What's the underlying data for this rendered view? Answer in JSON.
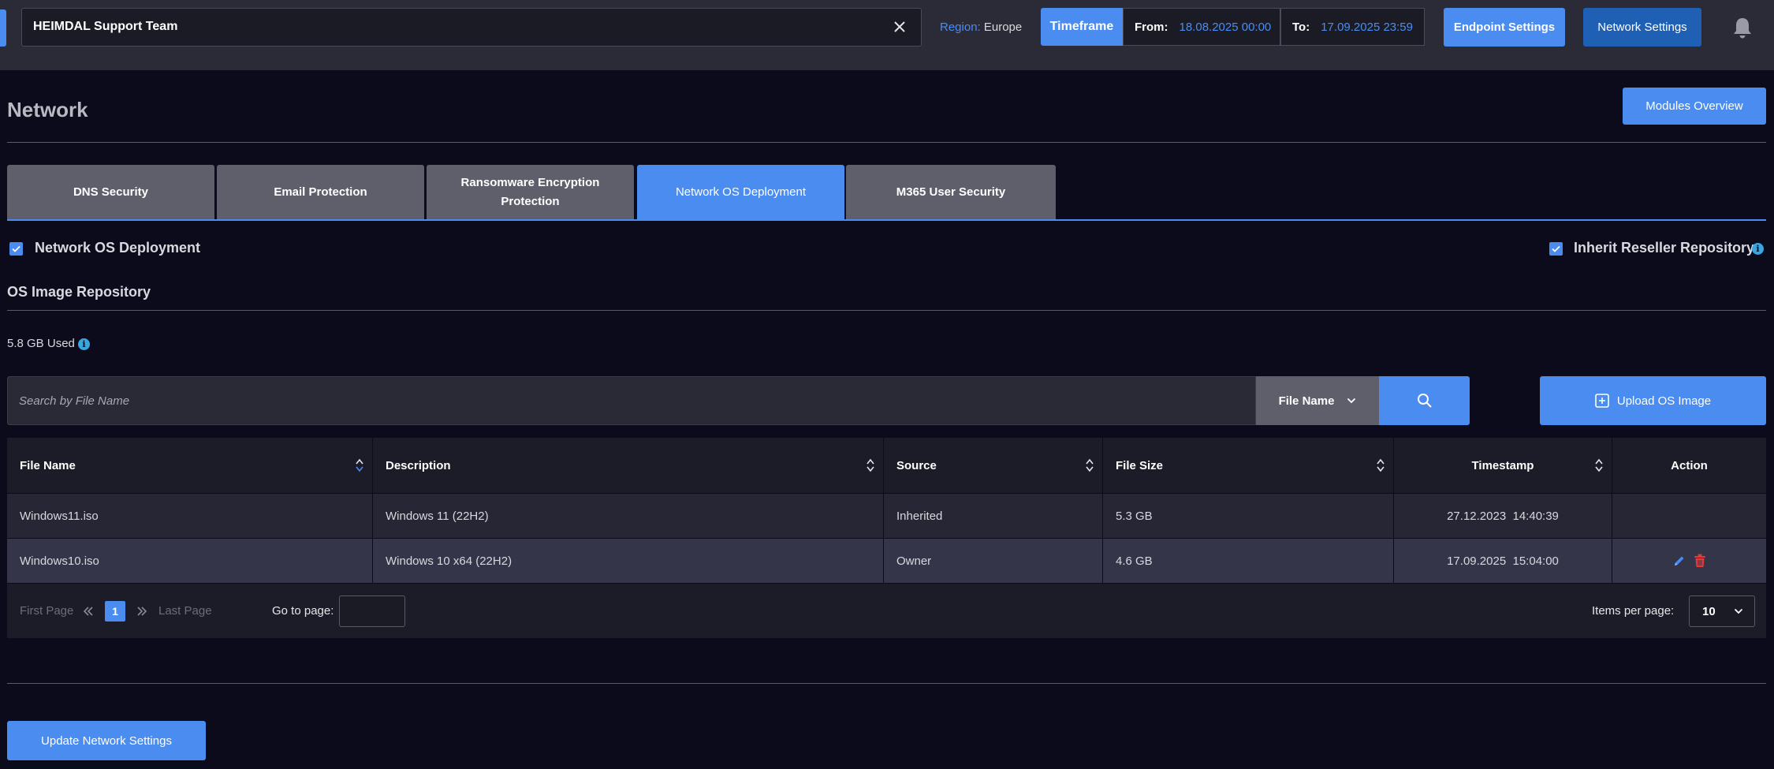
{
  "topbar": {
    "company": "HEIMDAL Support Team",
    "region_label": "Region:",
    "region_value": "Europe",
    "timeframe_label": "Timeframe",
    "from_label": "From:",
    "from_value": "18.08.2025 00:00",
    "to_label": "To:",
    "to_value": "17.09.2025 23:59",
    "endpoint_settings": "Endpoint Settings",
    "network_settings": "Network Settings"
  },
  "page": {
    "title": "Network",
    "modules_overview": "Modules Overview"
  },
  "tabs": [
    {
      "label": "DNS Security",
      "active": false
    },
    {
      "label": "Email Protection",
      "active": false
    },
    {
      "label": "Ransomware Encryption Protection",
      "active": false
    },
    {
      "label": "Network OS Deployment",
      "active": true
    },
    {
      "label": "M365 User Security",
      "active": false
    }
  ],
  "toggles": {
    "network_os_deployment": {
      "label": "Network OS Deployment",
      "checked": true
    },
    "inherit_reseller": {
      "label": "Inherit Reseller Repository",
      "checked": true
    }
  },
  "repository": {
    "title": "OS Image Repository",
    "usage": "5.8 GB Used"
  },
  "search": {
    "placeholder": "Search by File Name",
    "filter_value": "File Name",
    "upload_label": "Upload OS Image"
  },
  "table": {
    "columns": [
      "File Name",
      "Description",
      "Source",
      "File Size",
      "Timestamp",
      "Action"
    ],
    "rows": [
      {
        "file_name": "Windows11.iso",
        "description": "Windows 11 (22H2)",
        "source": "Inherited",
        "file_size": "5.3 GB",
        "timestamp": "27.12.2023  14:40:39",
        "actions": false
      },
      {
        "file_name": "Windows10.iso",
        "description": "Windows 10 x64 (22H2)",
        "source": "Owner",
        "file_size": "4.6 GB",
        "timestamp": "17.09.2025  15:04:00",
        "actions": true
      }
    ]
  },
  "pagination": {
    "first_page": "First Page",
    "current_page": "1",
    "last_page": "Last Page",
    "goto_label": "Go to page:",
    "items_per_page_label": "Items per page:",
    "items_per_page_value": "10"
  },
  "footer": {
    "update_button": "Update Network Settings"
  },
  "colors": {
    "accent": "#4a8cf0",
    "background": "#0b0b1c",
    "delete": "#e03b3b"
  }
}
